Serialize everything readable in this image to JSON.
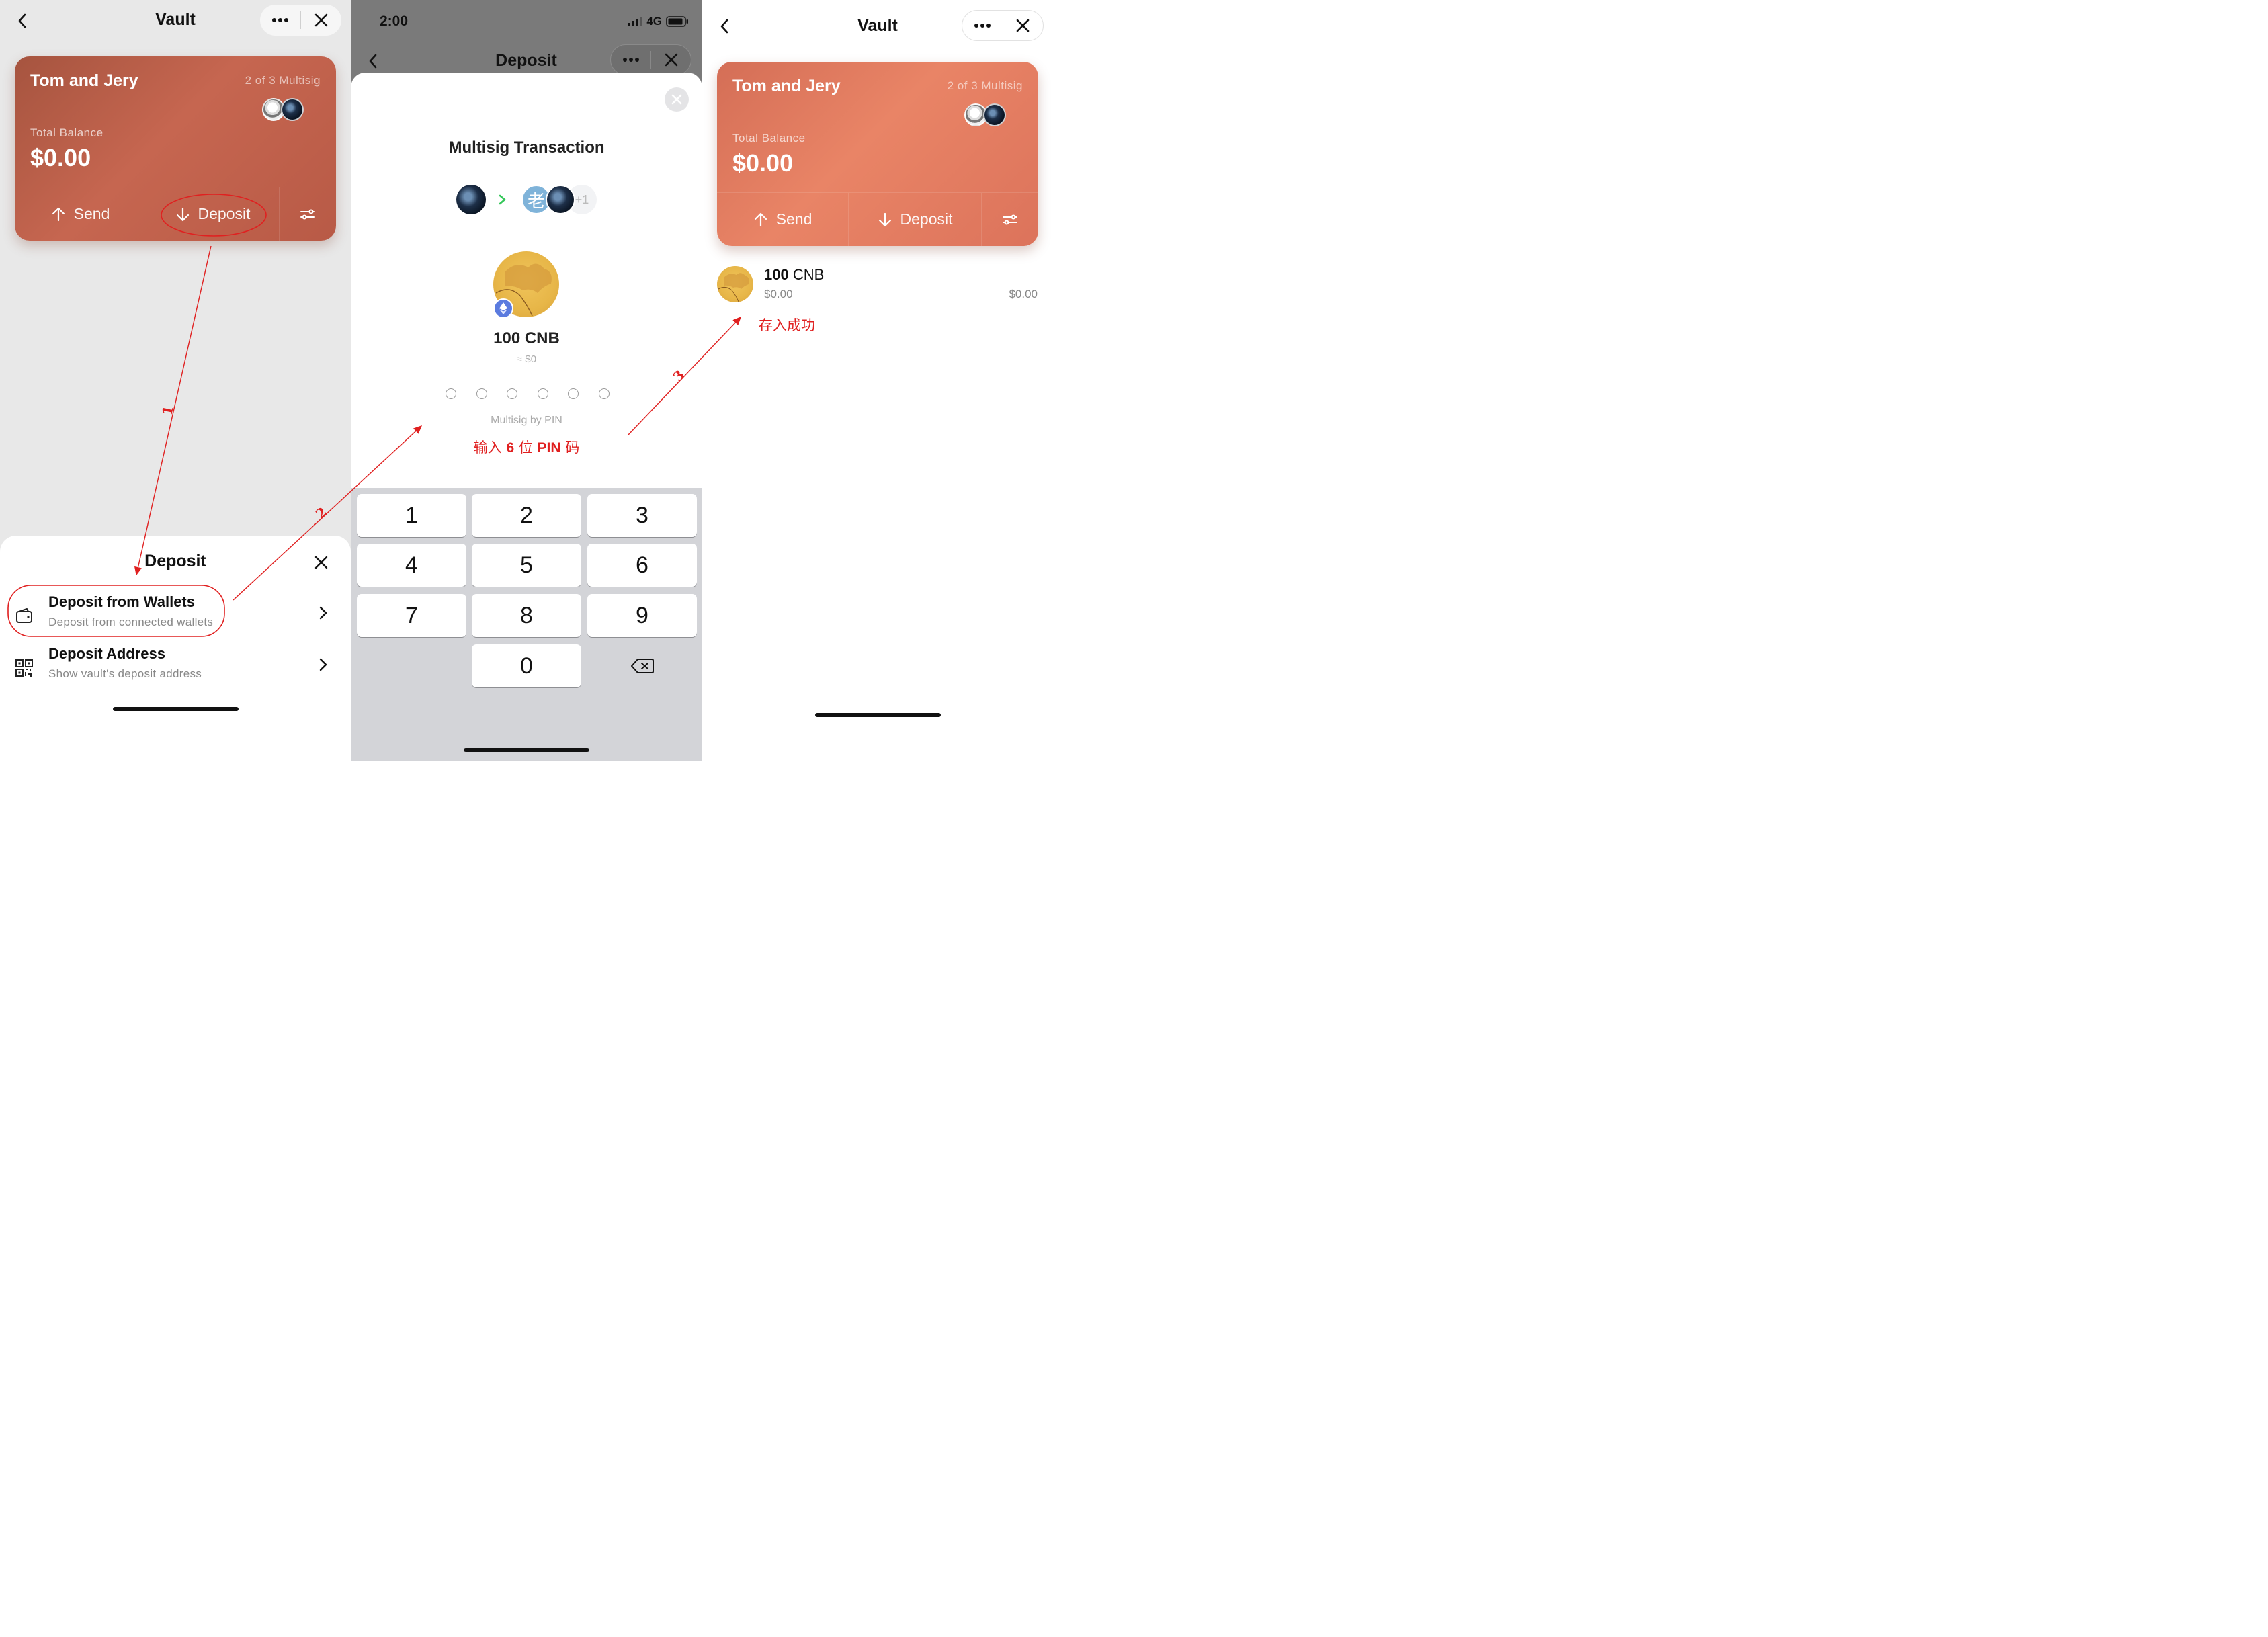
{
  "panel1": {
    "nav_title": "Vault",
    "card": {
      "name": "Tom and Jery",
      "multisig": "2 of 3 Multisig",
      "balance_label": "Total Balance",
      "balance": "$0.00",
      "send_label": "Send",
      "deposit_label": "Deposit"
    },
    "sheet": {
      "title": "Deposit",
      "options": [
        {
          "title": "Deposit from Wallets",
          "subtitle": "Deposit from connected wallets",
          "icon": "wallet-icon"
        },
        {
          "title": "Deposit Address",
          "subtitle": "Show vault's deposit address",
          "icon": "qr-code-icon"
        }
      ]
    }
  },
  "panel2": {
    "status": {
      "time": "2:00",
      "network": "4G"
    },
    "nav_title": "Deposit",
    "modal": {
      "title": "Multisig Transaction",
      "extra_signers": "+1",
      "receiver_initial": "老",
      "amount": "100 CNB",
      "approx": "≈ $0",
      "pin_label": "Multisig by PIN",
      "pin_length": 6,
      "annotation_prefix": "输入",
      "annotation_six": "6",
      "annotation_mid": "位",
      "annotation_pin": "PIN",
      "annotation_suffix": "码"
    },
    "keypad": [
      "1",
      "2",
      "3",
      "4",
      "5",
      "6",
      "7",
      "8",
      "9",
      "0"
    ]
  },
  "panel3": {
    "nav_title": "Vault",
    "card": {
      "name": "Tom and Jery",
      "multisig": "2 of 3 Multisig",
      "balance_label": "Total Balance",
      "balance": "$0.00",
      "send_label": "Send",
      "deposit_label": "Deposit"
    },
    "asset": {
      "amount": "100",
      "symbol": "CNB",
      "usd": "$0.00",
      "usd_right": "$0.00"
    },
    "annotation": "存入成功"
  },
  "step_labels": [
    "1",
    "2",
    "3"
  ],
  "colors": {
    "annotation_red": "#e02020",
    "card_dark": "#b85a46",
    "card_light": "#e3785d",
    "arrow_green": "#34c759"
  }
}
